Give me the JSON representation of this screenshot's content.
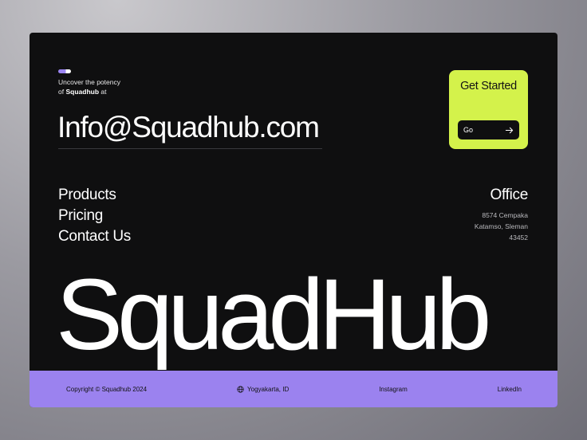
{
  "hero": {
    "tagline_line1": "Uncover the potency",
    "tagline_prefix": "of",
    "tagline_brand": "Squadhub",
    "tagline_suffix": "at",
    "email": "Info@Squadhub.com"
  },
  "cta": {
    "title": "Get Started",
    "button_label": "Go",
    "button_icon": "arrow-right-icon",
    "accent_color": "#d4f24b"
  },
  "nav": {
    "items": [
      {
        "label": "Products"
      },
      {
        "label": "Pricing"
      },
      {
        "label": "Contact Us"
      }
    ]
  },
  "office": {
    "title": "Office",
    "address": [
      "8574 Cempaka",
      "Katamso, Sleman",
      "43452"
    ]
  },
  "brand": {
    "wordmark": "SquadHub"
  },
  "footer": {
    "copyright": "Copyright © Squadhub 2024",
    "location": "Yogyakarta, ID",
    "location_icon": "globe-icon",
    "instagram": "Instagram",
    "linkedin": "LinkedIn",
    "background_color": "#9b82ef"
  },
  "theme": {
    "card_background": "#0f0f10",
    "pill_colors": [
      "#9a84f0",
      "#ffffff"
    ]
  }
}
